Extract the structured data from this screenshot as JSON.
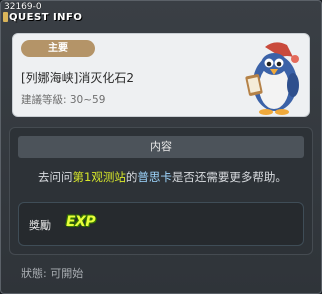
{
  "window": {
    "quest_id": "32169-0",
    "title": "QUEST INFO"
  },
  "quest": {
    "category_badge": "主要",
    "name": "[列娜海峡]消灭化石2",
    "level": "建議等級: 30~59"
  },
  "content": {
    "header": "内容",
    "desc_part1": "去问问",
    "desc_npc": "第1观测站",
    "desc_part2": "的",
    "desc_person": "普思卡",
    "desc_part3": "是否还需要更多帮助。"
  },
  "reward": {
    "label": "獎勵",
    "exp_text": "EXP"
  },
  "status": {
    "text": "狀態: 可開始"
  },
  "colors": {
    "highlight_yellow": "#d8e82a",
    "highlight_blue": "#9fd7ff",
    "badge": "#b49468"
  },
  "icons": {
    "npc": "penguin-npc-icon",
    "exp": "exp-icon"
  }
}
